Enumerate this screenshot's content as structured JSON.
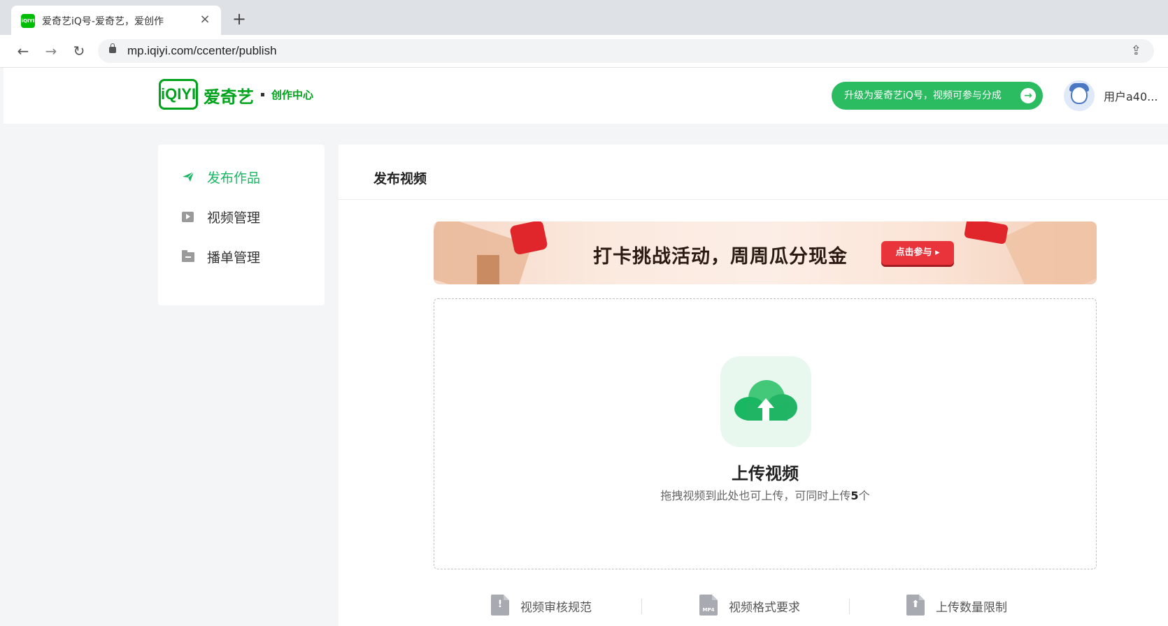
{
  "browser": {
    "tab_title": "爱奇艺iQ号-爱奇艺，爱创作",
    "tab_close": "×",
    "new_tab": "+",
    "favicon_text": "iQIYI",
    "url": "mp.iqiyi.com/ccenter/publish",
    "icons": [
      "back-icon",
      "forward-icon",
      "reload-icon",
      "lock-icon",
      "share-icon"
    ]
  },
  "header": {
    "logo_mark": "iQIYI",
    "logo_cn": "爱奇艺",
    "logo_sub": "创作中心",
    "upgrade_label": "升级为爱奇艺iQ号，视频可参与分成",
    "upgrade_arrow": "→",
    "username": "用户a40..."
  },
  "sidebar": {
    "items": [
      {
        "label": "发布作品",
        "icon": "send-icon",
        "active": true
      },
      {
        "label": "视频管理",
        "icon": "play-icon",
        "active": false
      },
      {
        "label": "播单管理",
        "icon": "folder-icon",
        "active": false
      }
    ]
  },
  "main": {
    "title": "发布视频",
    "banner": {
      "text": "打卡挑战活动，周周瓜分现金",
      "button": "点击参与 ▸"
    },
    "upload": {
      "title": "上传视频",
      "hint_prefix": "拖拽视频到此处也可上传，可同时上传",
      "hint_count": "5",
      "hint_suffix": "个"
    },
    "footer_links": [
      {
        "label": "视频审核规范",
        "icon": "review-icon",
        "mark": "!"
      },
      {
        "label": "视频格式要求",
        "icon": "mp4-file-icon",
        "mark": "MP4"
      },
      {
        "label": "上传数量限制",
        "icon": "upload-limit-icon",
        "mark": "⬆"
      }
    ]
  },
  "colors": {
    "brand_green": "#00a31b",
    "accent_green": "#1ab763",
    "upgrade_bg": "#2bbb61",
    "banner_button": "#e8343a"
  }
}
